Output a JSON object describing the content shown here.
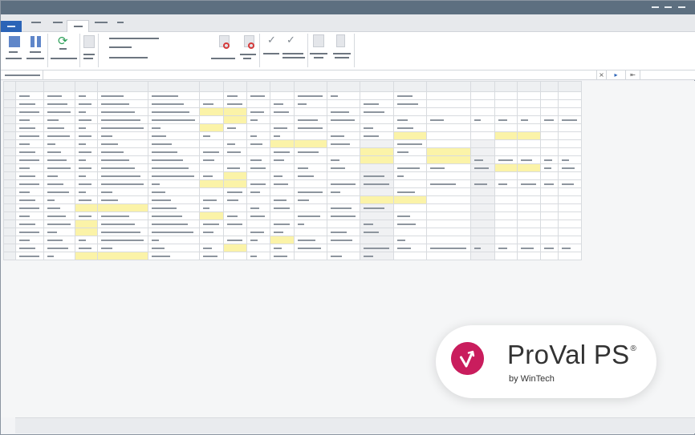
{
  "colors": {
    "title_bar": "#5d6f80",
    "file_tab": "#2b64b7",
    "highlight_cell": "#fbf3a8",
    "brand_magenta": "#c91d5d"
  },
  "badge": {
    "brand": "ProVal PS",
    "registered": "®",
    "byline": "by WinTech",
    "logo_icon": "v-check-logo-icon"
  },
  "formula_bar": {
    "cancel_glyph": "×",
    "confirm_glyph": "▸",
    "function_glyph": "⇤"
  }
}
